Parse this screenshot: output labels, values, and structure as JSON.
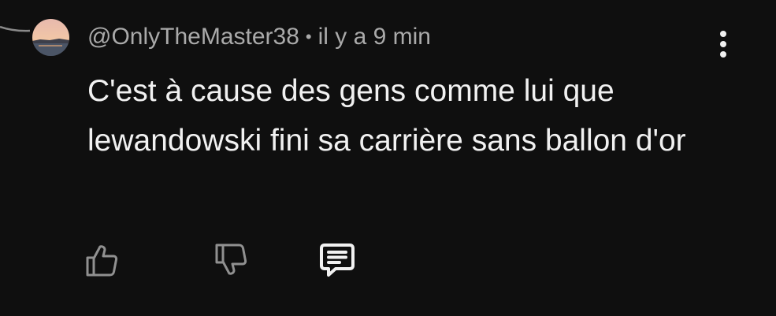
{
  "comment": {
    "author_handle": "@OnlyTheMaster38",
    "separator": "•",
    "timestamp": "il y a 9 min",
    "text": "C'est à cause des gens comme lui que lewandowski fini sa carrière sans ballon d'or"
  },
  "icons": {
    "avatar": "sunset-lake-avatar",
    "menu": "more-vert-icon",
    "like": "thumb-up-icon",
    "dislike": "thumb-down-icon",
    "reply": "reply-comment-icon"
  },
  "colors": {
    "background": "#0f0f0f",
    "primary_text": "#f1f1f1",
    "secondary_text": "#aaaaaa",
    "icon_muted": "#909090"
  }
}
